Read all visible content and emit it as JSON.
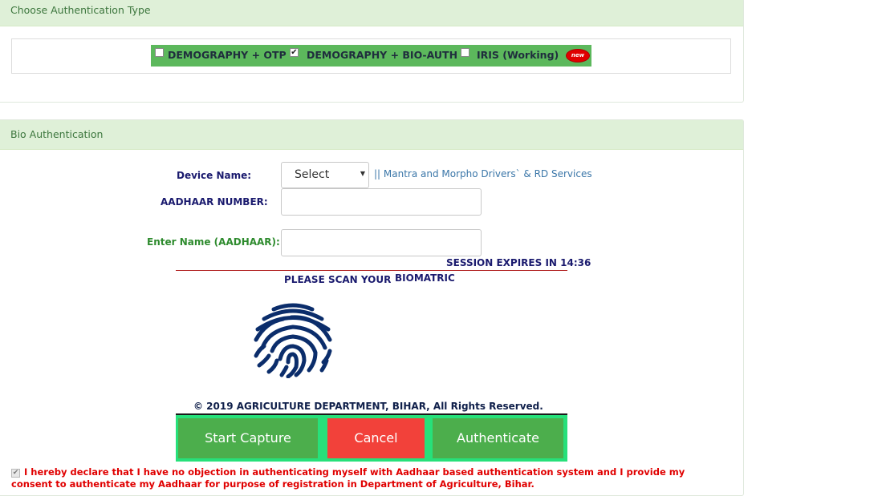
{
  "auth_type_panel": {
    "title": "Choose Authentication Type",
    "options": [
      {
        "label": "DEMOGRAPHY + OTP",
        "checked": false
      },
      {
        "label": "DEMOGRAPHY + BIO-AUTH",
        "checked": true
      },
      {
        "label": "IRIS (Working)",
        "checked": false
      }
    ],
    "new_badge": "new",
    "strip_color": "#5cb85c"
  },
  "bio_panel": {
    "title": "Bio Authentication",
    "device_label": "Device Name:",
    "device_select_value": "Select",
    "drivers_link": "|| Mantra and Morpho Drivers` & RD Services",
    "aadhaar_label": "AADHAAR NUMBER:",
    "aadhaar_value": "",
    "name_label": "Enter Name (AADHAAR):",
    "name_value": "",
    "session_text": "SESSION EXPIRES IN 14:36",
    "scan_text_a": "PLEASE SCAN YOUR",
    "scan_text_b": "BIOMATRIC",
    "fingerprint_icon": "fingerprint-icon",
    "copyright": "© 2019 AGRICULTURE DEPARTMENT, BIHAR, All Rights Reserved."
  },
  "buttons": {
    "start_capture": "Start Capture",
    "cancel": "Cancel",
    "authenticate": "Authenticate",
    "colors": {
      "start": "#4cae4c",
      "cancel": "#f2413a",
      "auth": "#4cae4c",
      "frame": "#27e07a"
    }
  },
  "consent": {
    "checked": true,
    "text": "I hereby declare that I have no objection in authenticating myself with Aadhaar based authentication system and I provide my consent to authenticate my Aadhaar for purpose of registration in Department of Agriculture, Bihar."
  }
}
